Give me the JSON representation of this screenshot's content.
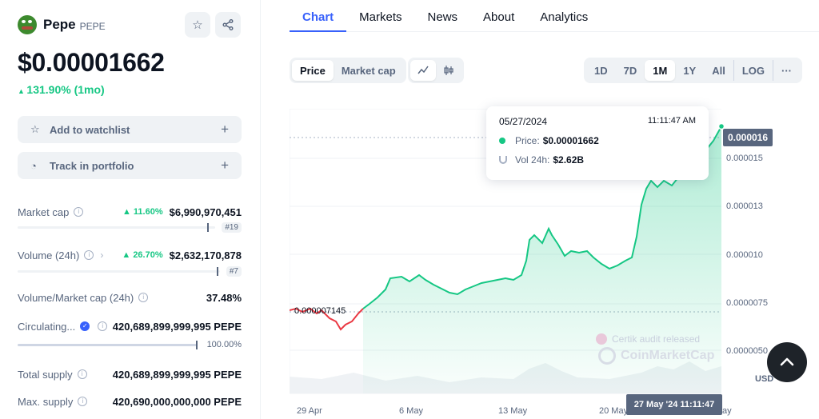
{
  "coin": {
    "name": "Pepe",
    "symbol": "PEPE",
    "price": "$0.00001662",
    "change": "131.90% (1mo)"
  },
  "actions": {
    "watchlist": "Add to watchlist",
    "portfolio": "Track in portfolio"
  },
  "stats": {
    "market_cap": {
      "label": "Market cap",
      "change": "11.60%",
      "value": "$6,990,970,451",
      "rank": "#19"
    },
    "volume": {
      "label": "Volume (24h)",
      "change": "26.70%",
      "value": "$2,632,170,878",
      "rank": "#7"
    },
    "vol_mcap": {
      "label": "Volume/Market cap (24h)",
      "value": "37.48%"
    },
    "circulating": {
      "label": "Circulating...",
      "value": "420,689,899,999,995 PEPE",
      "pct": "100.00%"
    },
    "total_supply": {
      "label": "Total supply",
      "value": "420,689,899,999,995 PEPE"
    },
    "max_supply": {
      "label": "Max. supply",
      "value": "420,690,000,000,000 PEPE"
    }
  },
  "tabs": [
    "Chart",
    "Markets",
    "News",
    "About",
    "Analytics"
  ],
  "chart_controls": {
    "type_toggle": [
      "Price",
      "Market cap"
    ],
    "ranges": [
      "1D",
      "7D",
      "1M",
      "1Y",
      "All",
      "LOG",
      "···"
    ]
  },
  "tooltip": {
    "date": "05/27/2024",
    "time": "11:11:47 AM",
    "price_label": "Price:",
    "price_value": "$0.00001662",
    "vol_label": "Vol 24h:",
    "vol_value": "$2.62B"
  },
  "axis": {
    "current_price": "0.000016",
    "y_ticks": [
      "0.000015",
      "0.000013",
      "0.000010",
      "0.0000075",
      "0.0000050"
    ],
    "currency": "USD",
    "x_ticks": [
      "29 Apr",
      "6 May",
      "13 May",
      "20 May"
    ],
    "x_last_partial": "ay",
    "hover_time": "27 May '24 11:11:47",
    "low_label": "0.000007145"
  },
  "watermark": {
    "certik": "Certik audit released",
    "brand": "CoinMarketCap"
  },
  "colors": {
    "up": "#16c784",
    "down": "#ea3943",
    "accent": "#3861fb"
  }
}
